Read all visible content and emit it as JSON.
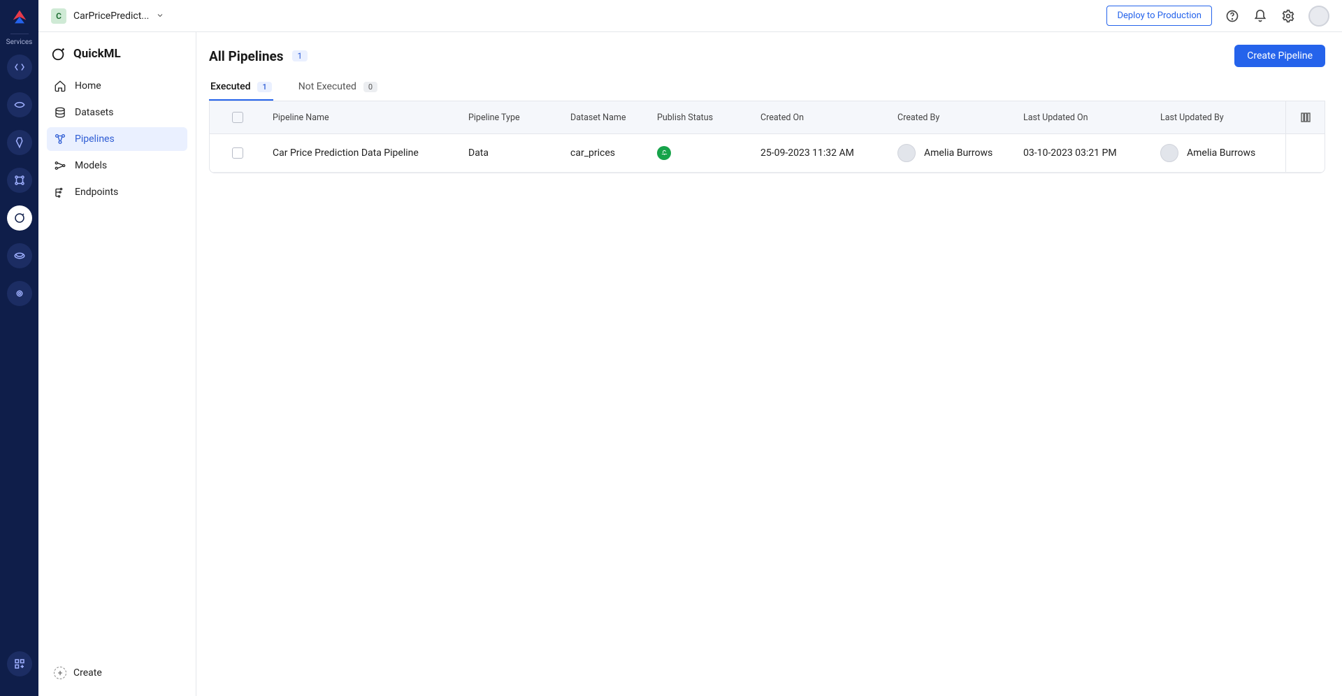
{
  "rail": {
    "label": "Services"
  },
  "topbar": {
    "project_initial": "C",
    "project_name": "CarPricePredict...",
    "deploy_label": "Deploy to Production"
  },
  "sidebar": {
    "app_title": "QuickML",
    "items": [
      {
        "label": "Home"
      },
      {
        "label": "Datasets"
      },
      {
        "label": "Pipelines"
      },
      {
        "label": "Models"
      },
      {
        "label": "Endpoints"
      }
    ],
    "create_label": "Create"
  },
  "page": {
    "title": "All Pipelines",
    "count": "1",
    "create_button": "Create Pipeline"
  },
  "tabs": [
    {
      "label": "Executed",
      "count": "1"
    },
    {
      "label": "Not Executed",
      "count": "0"
    }
  ],
  "table": {
    "headers": {
      "name": "Pipeline Name",
      "type": "Pipeline Type",
      "dataset": "Dataset Name",
      "publish": "Publish Status",
      "created_on": "Created On",
      "created_by": "Created By",
      "updated_on": "Last Updated On",
      "updated_by": "Last Updated By"
    },
    "rows": [
      {
        "name": "Car Price Prediction Data Pipeline",
        "type": "Data",
        "dataset": "car_prices",
        "created_on": "25-09-2023 11:32 AM",
        "created_by": "Amelia Burrows",
        "updated_on": "03-10-2023 03:21 PM",
        "updated_by": "Amelia Burrows"
      }
    ]
  }
}
